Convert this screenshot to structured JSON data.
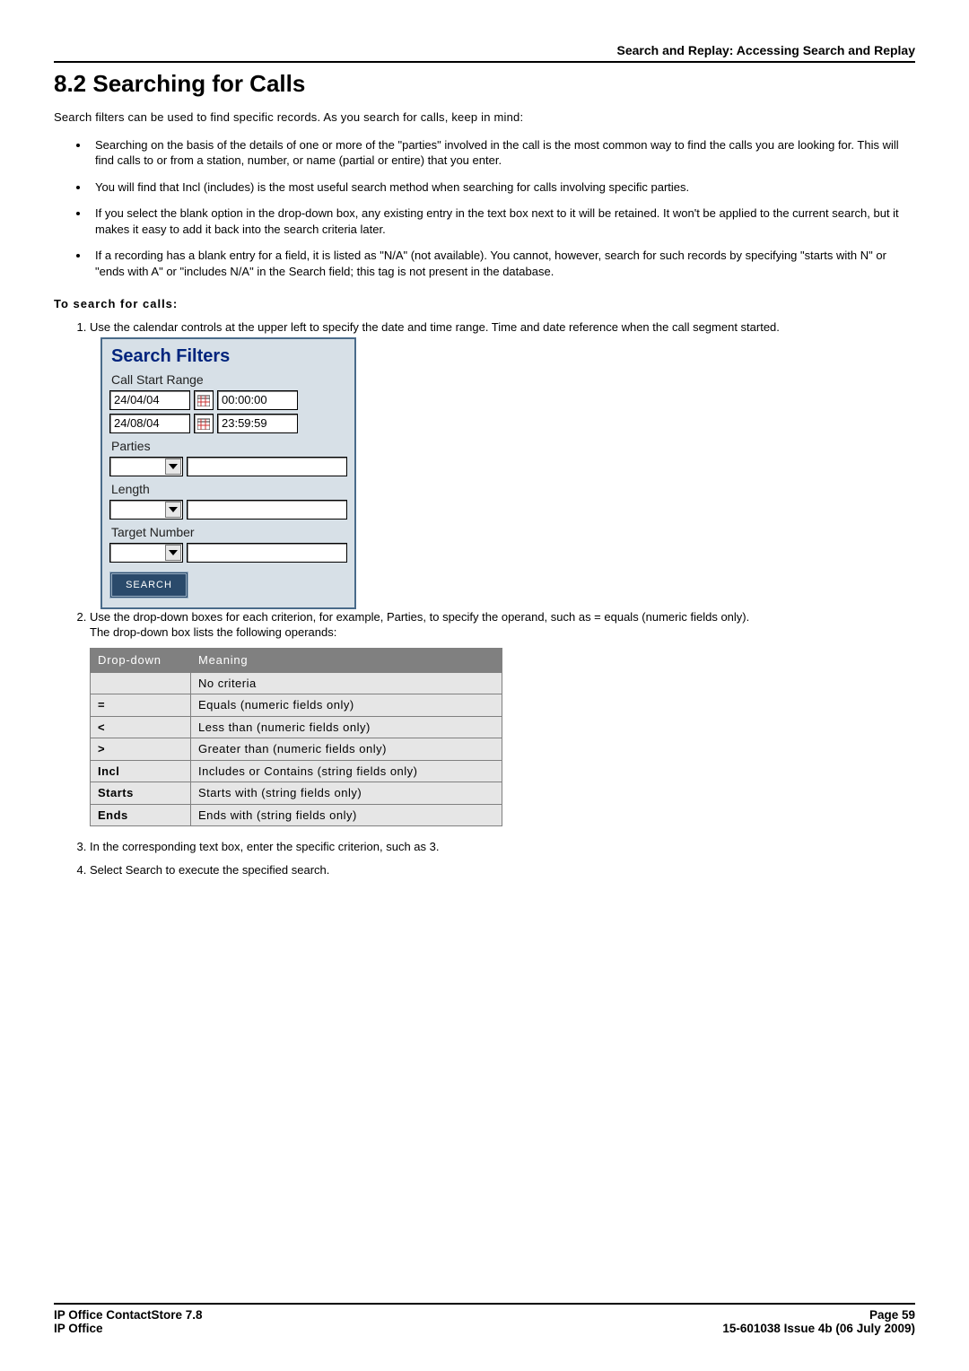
{
  "header": {
    "breadcrumb": "Search and Replay: Accessing Search and Replay"
  },
  "title": "8.2 Searching for Calls",
  "intro": "Search filters can be used to find specific records. As you search for calls, keep in mind:",
  "bullets": [
    "Searching on the basis of the details of one or more of the \"parties\" involved in the call is the most common way to find the calls you are looking for. This will find calls to or from a station, number, or name (partial or entire) that you enter.",
    "You will find that Incl (includes) is the most useful search method when searching for calls involving specific parties.",
    "If you select the blank option in the drop-down box, any existing entry in the text box next to it will be retained. It won't be applied to the current search, but it makes it easy to add it back into the search criteria later.",
    "If a recording has a blank entry for a field, it is listed as \"N/A\" (not available). You cannot, however, search for such records by specifying \"starts with N\" or \"ends with A\" or \"includes N/A\" in the Search field; this tag is not present in the database."
  ],
  "subhead": "To search for calls:",
  "step1": "Use the calendar controls at the upper left to specify the date and time range. Time and date reference when the call segment started.",
  "filters": {
    "title": "Search Filters",
    "range_label": "Call Start Range",
    "date_from": "24/04/04",
    "time_from": "00:00:00",
    "date_to": "24/08/04",
    "time_to": "23:59:59",
    "parties_label": "Parties",
    "length_label": "Length",
    "target_label": "Target Number",
    "search_btn": "SEARCH"
  },
  "step2_a": "Use the drop-down boxes for each criterion, for example, Parties, to specify the operand, such as = equals (numeric fields only).",
  "step2_b": "The drop-down box lists the following operands:",
  "op_table": {
    "head_dd": "Drop-down",
    "head_mean": "Meaning",
    "rows": [
      {
        "op": "",
        "mean": "No criteria"
      },
      {
        "op": "=",
        "mean": "Equals (numeric fields only)"
      },
      {
        "op": "<",
        "mean": "Less than (numeric fields only)"
      },
      {
        "op": ">",
        "mean": "Greater than (numeric fields only)"
      },
      {
        "op": "Incl",
        "mean": "Includes or Contains (string fields only)"
      },
      {
        "op": "Starts",
        "mean": "Starts with (string fields only)"
      },
      {
        "op": "Ends",
        "mean": "Ends with (string fields only)"
      }
    ]
  },
  "step3": "In the corresponding text box, enter the specific criterion, such as 3.",
  "step4": "Select Search to execute the specified search.",
  "footer": {
    "left1": "IP Office ContactStore 7.8",
    "left2": "IP Office",
    "right1": "Page 59",
    "right2": "15-601038 Issue 4b (06 July 2009)"
  }
}
